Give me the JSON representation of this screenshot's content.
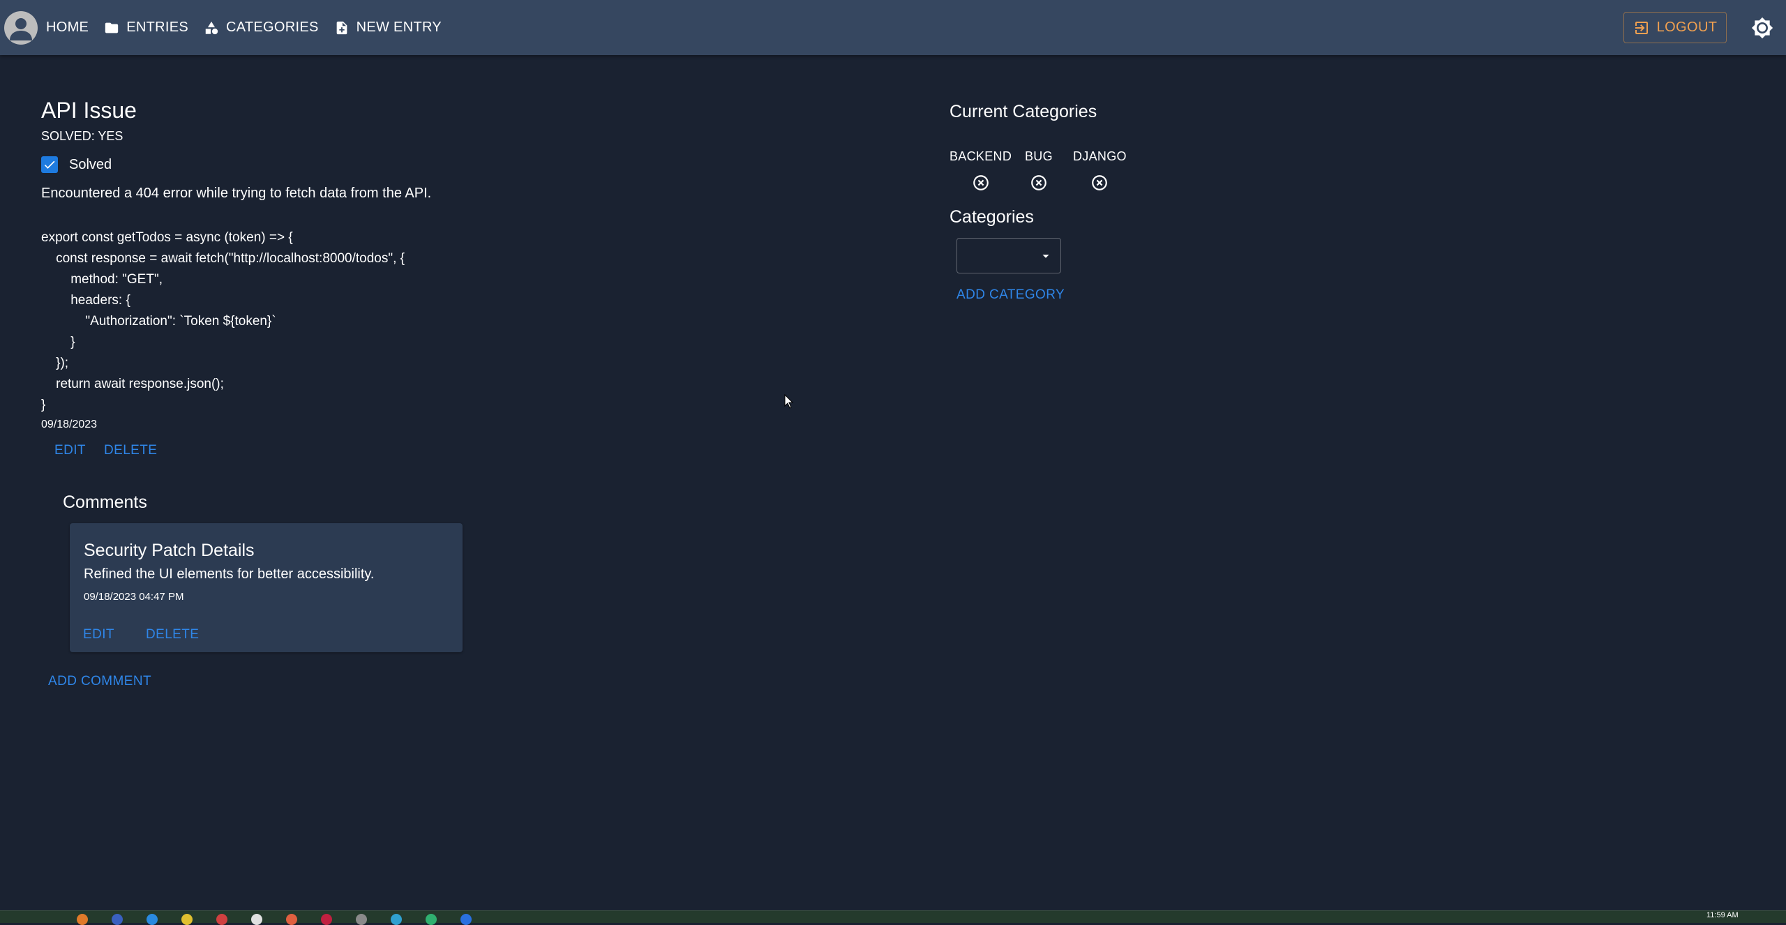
{
  "nav": {
    "items": [
      {
        "label": "HOME",
        "icon": "home-icon"
      },
      {
        "label": "ENTRIES",
        "icon": "folder-icon"
      },
      {
        "label": "CATEGORIES",
        "icon": "category-icon"
      },
      {
        "label": "NEW ENTRY",
        "icon": "note-add-icon"
      }
    ],
    "logout_label": "LOGOUT"
  },
  "entry": {
    "title": "API Issue",
    "solved_status": "SOLVED: YES",
    "solved_checkbox_label": "Solved",
    "solved_checked": true,
    "description": "Encountered a 404 error while trying to fetch data from the API.",
    "code": "export const getTodos = async (token) => {\n    const response = await fetch(\"http://localhost:8000/todos\", {\n        method: \"GET\",\n        headers: {\n            \"Authorization\": `Token ${token}`\n        }\n    });\n    return await response.json();\n}",
    "date": "09/18/2023",
    "edit_label": "EDIT",
    "delete_label": "DELETE"
  },
  "comments": {
    "title": "Comments",
    "items": [
      {
        "title": "Security Patch Details",
        "body": "Refined the UI elements for better accessibility.",
        "date": "09/18/2023 04:47 PM",
        "edit_label": "EDIT",
        "delete_label": "DELETE"
      }
    ],
    "add_label": "ADD COMMENT"
  },
  "categories": {
    "current_title": "Current Categories",
    "current": [
      "BACKEND",
      "BUG",
      "DJANGO"
    ],
    "select_title": "Categories",
    "select_value": "",
    "add_label": "ADD CATEGORY"
  },
  "taskbar": {
    "clock": "11:59 AM"
  },
  "colors": {
    "background": "#1a2231",
    "appbar": "#364760",
    "accent": "#2f86e8",
    "logout": "#f0a050",
    "card": "#2c3b52"
  }
}
